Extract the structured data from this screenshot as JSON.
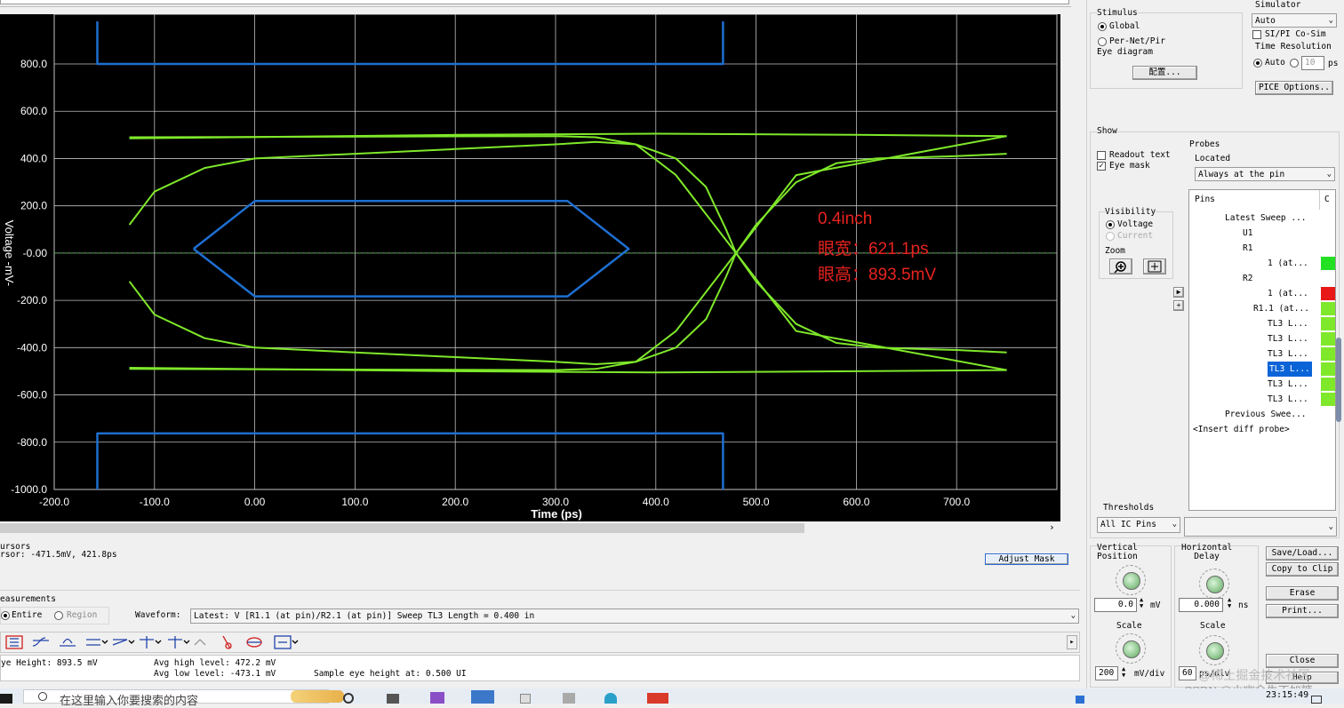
{
  "plot": {
    "y_axis_label": "Voltage -mV-",
    "x_axis_label": "Time (ps)",
    "y_ticks": [
      "800.0",
      "600.0",
      "400.0",
      "200.0",
      "-0.00",
      "-200.0",
      "-400.0",
      "-600.0",
      "-800.0",
      "-1000.0"
    ],
    "x_ticks": [
      "-200.0",
      "-100.0",
      "0.00",
      "100.0",
      "200.0",
      "300.0",
      "400.0",
      "500.0",
      "600.0",
      "700.0"
    ],
    "annotation": {
      "line1": "0.4inch",
      "line2": "眼宽：621.1ps",
      "line3": "眼高：893.5mV"
    },
    "colors": {
      "trace": "#7fe82a",
      "mask": "#1e6fd0",
      "annotation": "#e8231e",
      "background": "#000000"
    }
  },
  "chart_data": {
    "type": "line",
    "title": "",
    "xlabel": "Time (ps)",
    "ylabel": "Voltage -mV-",
    "xlim": [
      -200,
      740
    ],
    "ylim": [
      -1000,
      980
    ],
    "grid": true,
    "series": [
      {
        "kind": "trace",
        "x": [
          -125,
          -100,
          -50,
          0,
          100,
          200,
          300,
          340,
          380,
          420,
          450,
          470,
          480,
          500,
          540,
          580,
          620,
          660,
          700,
          750
        ],
        "y": [
          -120,
          -260,
          -360,
          -400,
          -420,
          -440,
          -460,
          -470,
          -460,
          -400,
          -280,
          -100,
          0,
          120,
          300,
          380,
          400,
          405,
          410,
          420
        ]
      },
      {
        "kind": "trace",
        "x": [
          -125,
          -100,
          -50,
          0,
          100,
          200,
          300,
          340,
          380,
          420,
          450,
          470,
          480,
          500,
          540,
          580,
          620,
          660,
          700,
          750
        ],
        "y": [
          120,
          260,
          360,
          400,
          420,
          440,
          460,
          470,
          460,
          400,
          280,
          100,
          0,
          -120,
          -300,
          -380,
          -400,
          -405,
          -410,
          -420
        ]
      },
      {
        "kind": "trace",
        "x": [
          -125,
          300,
          340,
          380,
          420,
          480,
          540,
          750
        ],
        "y": [
          490,
          495,
          490,
          460,
          330,
          0,
          -330,
          -495
        ]
      },
      {
        "kind": "trace",
        "x": [
          -125,
          300,
          340,
          380,
          420,
          480,
          540,
          750
        ],
        "y": [
          -490,
          -495,
          -490,
          -460,
          -330,
          0,
          330,
          495
        ]
      },
      {
        "kind": "trace",
        "x": [
          -125,
          200,
          400,
          600,
          750
        ],
        "y": [
          485,
          500,
          505,
          500,
          495
        ]
      },
      {
        "kind": "trace",
        "x": [
          -125,
          200,
          400,
          600,
          750
        ],
        "y": [
          -485,
          -500,
          -505,
          -500,
          -495
        ]
      },
      {
        "kind": "mask",
        "x": [
          -61,
          0,
          312,
          373,
          312,
          0,
          -61
        ],
        "y": [
          18,
          220,
          220,
          18,
          -183,
          -183,
          18
        ]
      },
      {
        "kind": "mask",
        "x": [
          -157,
          -157,
          467,
          467
        ],
        "y": [
          980,
          800,
          800,
          980
        ]
      },
      {
        "kind": "mask",
        "x": [
          -157,
          -157,
          467,
          467
        ],
        "y": [
          -1000,
          -763,
          -763,
          -1000
        ]
      }
    ]
  },
  "cursors": {
    "title": "ursors",
    "readout": "rsor: -471.5mV, 421.8ps",
    "adjust_mask": "Adjust Mask"
  },
  "measurements": {
    "title": "easurements",
    "entire": "Entire",
    "region": "Region",
    "waveform_label": "Waveform:",
    "waveform_value": "Latest: V [R1.1 (at pin)/R2.1 (at pin)] Sweep TL3 Length = 0.400 in",
    "eye_height": "ye Height: 893.5 mV",
    "avg_high": "Avg high level: 472.2 mV",
    "avg_low": "Avg low level: -473.1 mV",
    "sample_at": "Sample eye height at: 0.500 UI"
  },
  "right": {
    "stimulus_title": "Stimulus",
    "global": "Global",
    "per_net": "Per-Net/Pir",
    "eye_diagram": "Eye diagram",
    "config_button": "配置...",
    "simulator_title": "Simulator",
    "simulator_value": "Auto",
    "sipi": "SI/PI Co-Sim",
    "time_res": "Time Resolution",
    "auto": "Auto",
    "time_res_value": "10",
    "ps": "ps",
    "spice_options": "PICE Options..",
    "show_title": "Show",
    "readout_text": "Readout text",
    "eye_mask": "Eye mask",
    "probes_title": "Probes",
    "located": "Located",
    "located_value": "Always at the pin",
    "visibility": "Visibility",
    "voltage": "Voltage",
    "current": "Current",
    "zoom": "Zoom",
    "pins_header": "Pins",
    "col_c": "C",
    "thresholds": "Thresholds",
    "thresholds_value": "All IC Pins",
    "tree": [
      {
        "label": "Latest Sweep ...",
        "indent": 36
      },
      {
        "label": "U1",
        "indent": 56
      },
      {
        "label": "R1",
        "indent": 56
      },
      {
        "label": "1 (at...",
        "indent": 84,
        "color": "#22e022"
      },
      {
        "label": "R2",
        "indent": 56
      },
      {
        "label": "1 (at...",
        "indent": 84,
        "color": "#e81818"
      },
      {
        "label": "R1.1 (at...",
        "indent": 68,
        "color": "#7fe82a"
      },
      {
        "label": "TL3 L...",
        "indent": 84,
        "color": "#7fe82a"
      },
      {
        "label": "TL3 L...",
        "indent": 84,
        "color": "#7fe82a"
      },
      {
        "label": "TL3 L...",
        "indent": 84,
        "color": "#7fe82a"
      },
      {
        "label": "TL3 L...",
        "indent": 84,
        "color": "#7fe82a",
        "selected": true
      },
      {
        "label": "TL3 L...",
        "indent": 84,
        "color": "#7fe82a"
      },
      {
        "label": "TL3 L...",
        "indent": 84,
        "color": "#7fe82a"
      },
      {
        "label": "Previous Swee...",
        "indent": 36
      },
      {
        "label": "<Insert diff probe>",
        "indent": 0
      }
    ]
  },
  "bottom_right": {
    "vertical_position": "Vertical\nPosition",
    "vertical_value": "0.0",
    "mv": "mV",
    "horizontal_delay": "Horizontal\nDelay",
    "horizontal_value": "0.000",
    "ns": "ns",
    "scale": "Scale",
    "scale_v_value": "200",
    "mv_div": "mV/div",
    "scale_h_value": "60",
    "ps_div": "ps/div",
    "save_load": "Save/Load...",
    "copy_clip": "Copy to Clip",
    "erase": "Erase",
    "print": "Print...",
    "close": "Close",
    "help": "Help"
  },
  "taskbar": {
    "search_placeholder": "在这里输入你要搜索的内容",
    "time": "23:15:49",
    "watermark1": "@稀土掘金技术社区",
    "watermark2": "CSDN @小幽余生不加糖"
  }
}
